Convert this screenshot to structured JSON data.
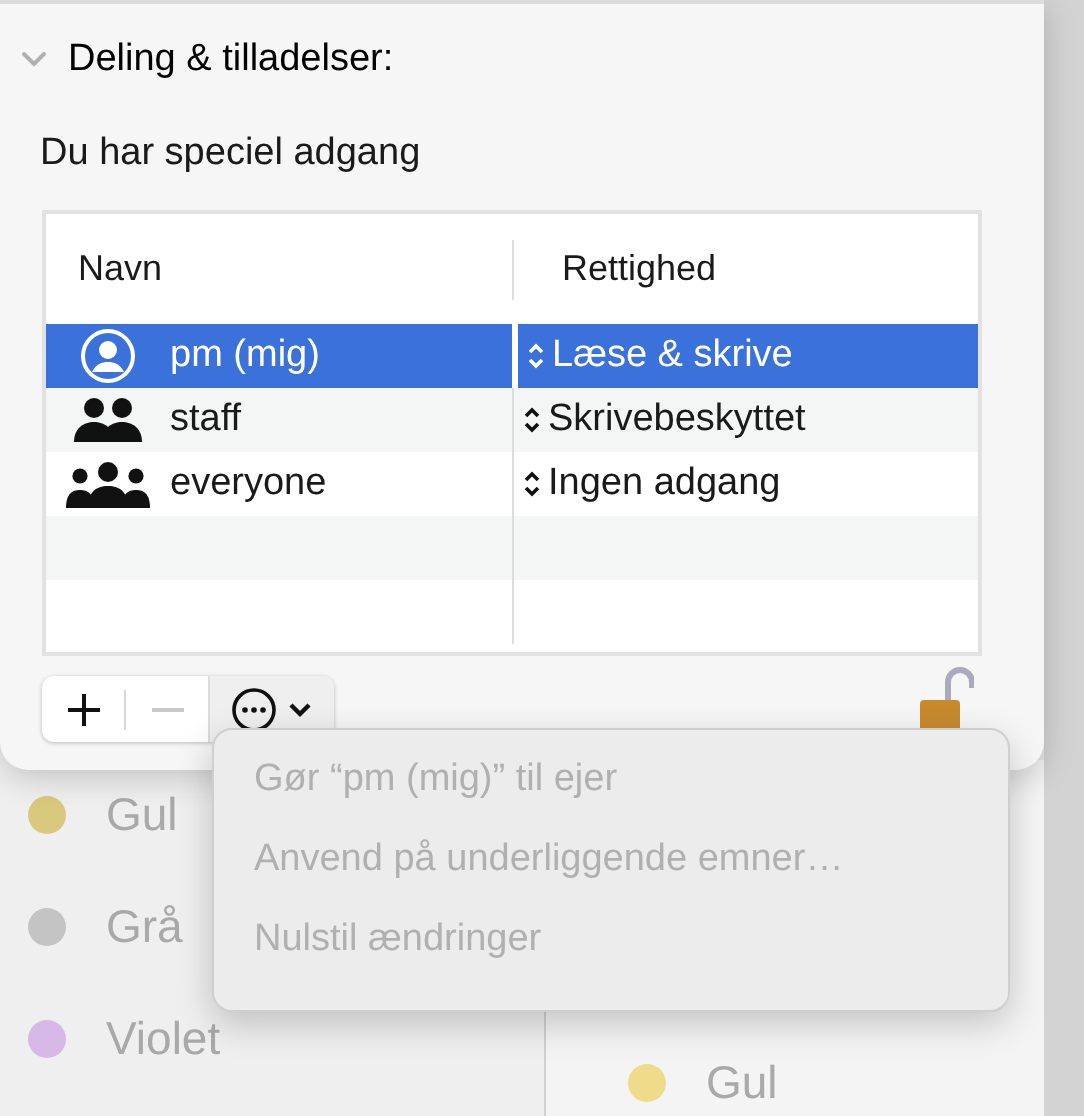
{
  "section": {
    "title": "Deling & tilladelser:",
    "expanded": true
  },
  "access_note": "Du har speciel adgang",
  "table": {
    "columns": [
      "Navn",
      "Rettighed"
    ],
    "rows": [
      {
        "kind": "user",
        "name": "pm (mig)",
        "privilege": "Læse & skrive",
        "selected": true
      },
      {
        "kind": "group",
        "name": "staff",
        "privilege": "Skrivebeskyttet",
        "selected": false
      },
      {
        "kind": "everyone",
        "name": "everyone",
        "privilege": "Ingen adgang",
        "selected": false
      }
    ]
  },
  "toolbar": {
    "remove_disabled": true,
    "locked": false
  },
  "menu": [
    {
      "label": "Gør “pm (mig)” til ejer",
      "disabled": true
    },
    {
      "label": "Anvend på underliggende emner…",
      "disabled": true
    },
    {
      "label": "Nulstil ændringer",
      "disabled": true
    }
  ],
  "background_tags_left": [
    {
      "label": "Gul",
      "color": "#d9c97c"
    },
    {
      "label": "Grå",
      "color": "#c4c4c4"
    },
    {
      "label": "Violet",
      "color": "#d7b9e8"
    }
  ],
  "background_tags_right": [
    {
      "label": "Gul",
      "color": "#efdc8a"
    }
  ]
}
